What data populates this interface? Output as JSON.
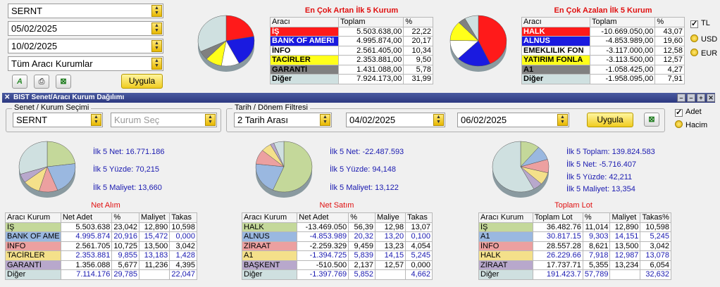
{
  "top": {
    "symbol": "SERNT",
    "date_start": "05/02/2025",
    "date_end": "10/02/2025",
    "institutions": "Tüm Aracı Kurumlar",
    "apply_label": "Uygula",
    "gainers_title": "En Çok Artan İlk 5 Kurum",
    "losers_title": "En Çok Azalan İlk 5 Kurum",
    "headers": [
      "Aracı",
      "Toplam",
      "%"
    ],
    "gainers": [
      {
        "name": "İŞ",
        "total": "5.503.638,00",
        "pct": "22,22",
        "bg": "#ff1a1a",
        "fg": "#ffffff"
      },
      {
        "name": "BANK OF AMERI",
        "total": "4.995.874,00",
        "pct": "20,17",
        "bg": "#1a1ae0",
        "fg": "#ffffff"
      },
      {
        "name": "İNFO",
        "total": "2.561.405,00",
        "pct": "10,34",
        "bg": "#ffffff",
        "fg": "#000000"
      },
      {
        "name": "TACİRLER",
        "total": "2.353.881,00",
        "pct": "9,50",
        "bg": "#ffff1a",
        "fg": "#000000"
      },
      {
        "name": "GARANTİ",
        "total": "1.431.088,00",
        "pct": "5,78",
        "bg": "#808080",
        "fg": "#000000"
      },
      {
        "name": "Diğer",
        "total": "7.924.173,00",
        "pct": "31,99",
        "bg": "#cfe0e0",
        "fg": "#000000"
      }
    ],
    "losers": [
      {
        "name": "HALK",
        "total": "-10.669.050,00",
        "pct": "43,07",
        "bg": "#ff1a1a",
        "fg": "#ffffff"
      },
      {
        "name": "ALNUS",
        "total": "-4.853.989,00",
        "pct": "19,60",
        "bg": "#1a1ae0",
        "fg": "#ffffff"
      },
      {
        "name": "EMEKLILIK FON",
        "total": "-3.117.000,00",
        "pct": "12,58",
        "bg": "#ffffff",
        "fg": "#000000"
      },
      {
        "name": "YATIRIM FONLA",
        "total": "-3.113.500,00",
        "pct": "12,57",
        "bg": "#ffff1a",
        "fg": "#000000"
      },
      {
        "name": "A1",
        "total": "-1.058.425,00",
        "pct": "4,27",
        "bg": "#808080",
        "fg": "#000000"
      },
      {
        "name": "Diğer",
        "total": "-1.958.095,00",
        "pct": "7,91",
        "bg": "#cfe0e0",
        "fg": "#000000"
      }
    ],
    "currency": [
      "TL",
      "USD",
      "EUR"
    ]
  },
  "panel": {
    "title": "BIST Senet/Aracı Kurum Dağılımı",
    "group1_title": "Senet / Kurum Seçimi",
    "symbol": "SERNT",
    "kurum_placeholder": "Kurum Seç",
    "group2_title": "Tarih / Dönem Filtresi",
    "period": "2 Tarih Arası",
    "date_start": "04/02/2025",
    "date_end": "06/02/2025",
    "apply_label": "Uygula",
    "mode": [
      "Adet",
      "Hacim"
    ]
  },
  "buy": {
    "title": "Net Alım",
    "stats": [
      "İlk 5 Net: 16.771.186",
      "İlk 5 Yüzde: 70,215",
      "İlk 5 Maliyet: 13,660"
    ],
    "headers": [
      "Aracı Kurum",
      "Net Adet",
      "%",
      "Maliyet",
      "Takas"
    ],
    "rows": [
      {
        "name": "İŞ",
        "a": "5.503.638",
        "p": "23,042",
        "m": "12,890",
        "t": "10,598",
        "bg": "#c4d89a",
        "blue": false
      },
      {
        "name": "BANK OF AME",
        "a": "4.995.874",
        "p": "20,916",
        "m": "15,472",
        "t": "0,000",
        "bg": "#9ab8e0",
        "blue": true
      },
      {
        "name": "İNFO",
        "a": "2.561.705",
        "p": "10,725",
        "m": "13,500",
        "t": "3,042",
        "bg": "#eca0a0",
        "blue": false
      },
      {
        "name": "TACİRLER",
        "a": "2.353.881",
        "p": "9,855",
        "m": "13,183",
        "t": "1,428",
        "bg": "#f4e08a",
        "blue": true
      },
      {
        "name": "GARANTİ",
        "a": "1.356.088",
        "p": "5,677",
        "m": "11,236",
        "t": "4,395",
        "bg": "#b8a8cc",
        "blue": false
      },
      {
        "name": "Diğer",
        "a": "7.114.176",
        "p": "29,785",
        "m": "",
        "t": "22,047",
        "bg": "#cfe0e0",
        "blue": true
      }
    ]
  },
  "sell": {
    "title": "Net Satım",
    "stats": [
      "İlk 5 Net: -22.487.593",
      "İlk 5 Yüzde: 94,148",
      "İlk 5 Maliyet: 13,122"
    ],
    "headers": [
      "Aracı Kurum",
      "Net Adet",
      "%",
      "Maliye",
      "Takas"
    ],
    "rows": [
      {
        "name": "HALK",
        "a": "-13.469.050",
        "p": "56,39",
        "m": "12,98",
        "t": "13,07",
        "bg": "#c4d89a",
        "blue": false
      },
      {
        "name": "ALNUS",
        "a": "-4.853.989",
        "p": "20,32",
        "m": "13,20",
        "t": "0,100",
        "bg": "#9ab8e0",
        "blue": true
      },
      {
        "name": "ZİRAAT",
        "a": "-2.259.329",
        "p": "9,459",
        "m": "13,23",
        "t": "4,054",
        "bg": "#eca0a0",
        "blue": false
      },
      {
        "name": "A1",
        "a": "-1.394.725",
        "p": "5,839",
        "m": "14,15",
        "t": "5,245",
        "bg": "#f4e08a",
        "blue": true
      },
      {
        "name": "BAŞKENT",
        "a": "-510.500",
        "p": "2,137",
        "m": "12,57",
        "t": "0,000",
        "bg": "#b8a8cc",
        "blue": false
      },
      {
        "name": "Diğer",
        "a": "-1.397.769",
        "p": "5,852",
        "m": "",
        "t": "4,662",
        "bg": "#cfe0e0",
        "blue": true
      }
    ]
  },
  "lot": {
    "title": "Toplam Lot",
    "stats": [
      "İlk 5 Toplam: 139.824.583",
      "İlk 5 Net: -5.716.407",
      "İlk 5 Yüzde: 42,211",
      "İlk 5 Maliyet: 13,354"
    ],
    "headers": [
      "Aracı Kurum",
      "Toplam Lot",
      "%",
      "Maliyet",
      "Takas%"
    ],
    "rows": [
      {
        "name": "İŞ",
        "a": "36.482.76",
        "p": "11,014",
        "m": "12,890",
        "t": "10,598",
        "bg": "#c4d89a",
        "blue": false
      },
      {
        "name": "A1",
        "a": "30.817.15",
        "p": "9,303",
        "m": "14,151",
        "t": "5,245",
        "bg": "#9ab8e0",
        "blue": true
      },
      {
        "name": "İNFO",
        "a": "28.557.28",
        "p": "8,621",
        "m": "13,500",
        "t": "3,042",
        "bg": "#eca0a0",
        "blue": false
      },
      {
        "name": "HALK",
        "a": "26.229.66",
        "p": "7,918",
        "m": "12,987",
        "t": "13,078",
        "bg": "#f4e08a",
        "blue": true
      },
      {
        "name": "ZİRAAT",
        "a": "17.737.71",
        "p": "5,355",
        "m": "13,234",
        "t": "6,054",
        "bg": "#b8a8cc",
        "blue": false
      },
      {
        "name": "Diğer",
        "a": "191.423.7",
        "p": "57,789",
        "m": "",
        "t": "32,632",
        "bg": "#cfe0e0",
        "blue": true
      }
    ]
  },
  "pies": {
    "gainers": {
      "values": [
        22.22,
        20.17,
        10.34,
        9.5,
        5.78,
        31.99
      ],
      "colors": [
        "#ff1a1a",
        "#1a1ae0",
        "#ffffff",
        "#ffff1a",
        "#808080",
        "#cfe0e0"
      ]
    },
    "losers": {
      "values": [
        43.07,
        19.6,
        12.58,
        12.57,
        4.27,
        7.91
      ],
      "colors": [
        "#ff1a1a",
        "#1a1ae0",
        "#ffffff",
        "#ffff1a",
        "#808080",
        "#cfe0e0"
      ]
    },
    "buy": {
      "values": [
        23.042,
        20.916,
        10.725,
        9.855,
        5.677,
        29.785
      ],
      "colors": [
        "#c4d89a",
        "#9ab8e0",
        "#eca0a0",
        "#f4e08a",
        "#b8a8cc",
        "#cfe0e0"
      ]
    },
    "sell": {
      "values": [
        56.39,
        20.32,
        9.459,
        5.839,
        2.137,
        5.852
      ],
      "colors": [
        "#c4d89a",
        "#9ab8e0",
        "#eca0a0",
        "#f4e08a",
        "#b8a8cc",
        "#cfe0e0"
      ]
    },
    "lot": {
      "values": [
        11.014,
        9.303,
        8.621,
        7.918,
        5.355,
        57.789
      ],
      "colors": [
        "#c4d89a",
        "#9ab8e0",
        "#eca0a0",
        "#f4e08a",
        "#b8a8cc",
        "#cfe0e0"
      ]
    }
  }
}
